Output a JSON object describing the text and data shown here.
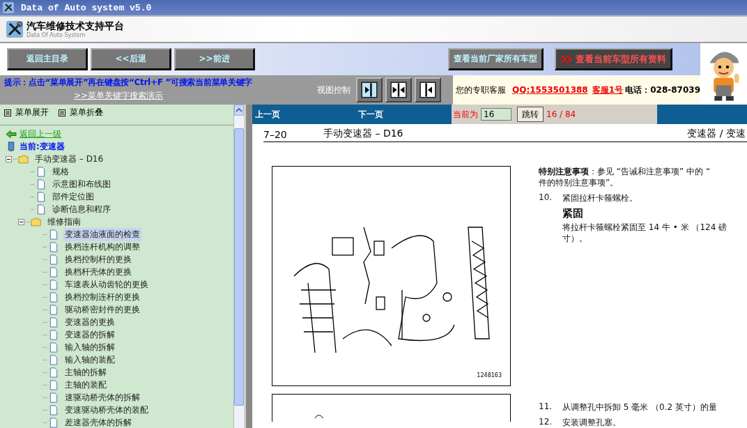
{
  "window": {
    "title": "Data of Auto system v5.0"
  },
  "header": {
    "title": "汽车维修技术支持平台",
    "subtitle": "Data Of Auto System"
  },
  "toolbar": {
    "buttons": [
      {
        "label": "返回主目录",
        "kind": "nav"
      },
      {
        "label": "<<后退",
        "kind": "nav"
      },
      {
        "label": ">>前进",
        "kind": "nav"
      }
    ],
    "actions": [
      {
        "label": "查看当前厂家所有车型",
        "kind": "plain"
      },
      {
        "label": "查看当前车型所有资料",
        "kind": "highlight"
      }
    ]
  },
  "hint": {
    "text": "提示：点击“菜单展开”再在键盘按“Ctrl+F ”可搜索当前菜单关键字",
    "link": ">>菜单关键字搜索演示"
  },
  "view_control": {
    "label": "视图控制"
  },
  "service": {
    "label": "您的专职客服",
    "qq": "QQ:1553501388",
    "agent": "客服1号",
    "phone_label": "电话：",
    "phone": "028-87039"
  },
  "menu": {
    "expand": "菜单展开",
    "collapse": "菜单折叠",
    "back": "返回上一级",
    "current": "当前:变速器"
  },
  "tree": [
    {
      "label": "手动变速器 – D16",
      "kind": "folder",
      "expanded": true,
      "selected": false,
      "children": [
        {
          "label": "规格",
          "kind": "page",
          "selected": false
        },
        {
          "label": "示意图和布线图",
          "kind": "page",
          "selected": false
        },
        {
          "label": "部件定位图",
          "kind": "page",
          "selected": false
        },
        {
          "label": "诊断信息和程序",
          "kind": "page",
          "selected": false
        },
        {
          "label": "维修指南",
          "kind": "folder",
          "expanded": true,
          "selected": false,
          "children": [
            {
              "label": "变速器油液面的检查",
              "kind": "page",
              "selected": true
            },
            {
              "label": "换档连杆机构的调整",
              "kind": "page",
              "selected": false
            },
            {
              "label": "换档控制杆的更换",
              "kind": "page",
              "selected": false
            },
            {
              "label": "换档杆壳体的更换",
              "kind": "page",
              "selected": false
            },
            {
              "label": "车速表从动齿轮的更换",
              "kind": "page",
              "selected": false
            },
            {
              "label": "换档控制连杆的更换",
              "kind": "page",
              "selected": false
            },
            {
              "label": "驱动桥密封件的更换",
              "kind": "page",
              "selected": false
            },
            {
              "label": "变速器的更换",
              "kind": "page",
              "selected": false
            },
            {
              "label": "变速器的拆解",
              "kind": "page",
              "selected": false
            },
            {
              "label": "输入轴的拆解",
              "kind": "page",
              "selected": false
            },
            {
              "label": "输入轴的装配",
              "kind": "page",
              "selected": false
            },
            {
              "label": "主轴的拆解",
              "kind": "page",
              "selected": false
            },
            {
              "label": "主轴的装配",
              "kind": "page",
              "selected": false
            },
            {
              "label": "速驱动桥壳体的拆解",
              "kind": "page",
              "selected": false
            },
            {
              "label": "变速驱动桥壳体的装配",
              "kind": "page",
              "selected": false
            },
            {
              "label": "差速器壳体的拆解",
              "kind": "page",
              "selected": false
            }
          ]
        }
      ]
    }
  ],
  "pager": {
    "prev": "上一页",
    "next": "下一页",
    "current_label": "当前为",
    "page_value": "16",
    "go": "跳转",
    "count": "16 / 84"
  },
  "document": {
    "page_number": "7–20",
    "chapter": "手动变速器 – D16",
    "section": "变速器 / 变速",
    "figure_caption": "1248163",
    "note_lines": [
      "**特别注意事项**：参见 “告诫和注意事项” 中的 “",
      "件的特别注意事项”。"
    ],
    "steps": [
      {
        "number": "10.",
        "text": "紧固拉杆卡箍螺栓。",
        "subheading": "紧固",
        "detail_lines": [
          "将拉杆卡箍螺栓紧固至 14 牛 • 米 （124 磅",
          "寸）。"
        ]
      },
      {
        "number": "11.",
        "text": "从调整孔中拆卸 5 毫米 （0.2 英寸）的量"
      },
      {
        "number": "12.",
        "text": "安装调整孔塞。"
      }
    ]
  }
}
